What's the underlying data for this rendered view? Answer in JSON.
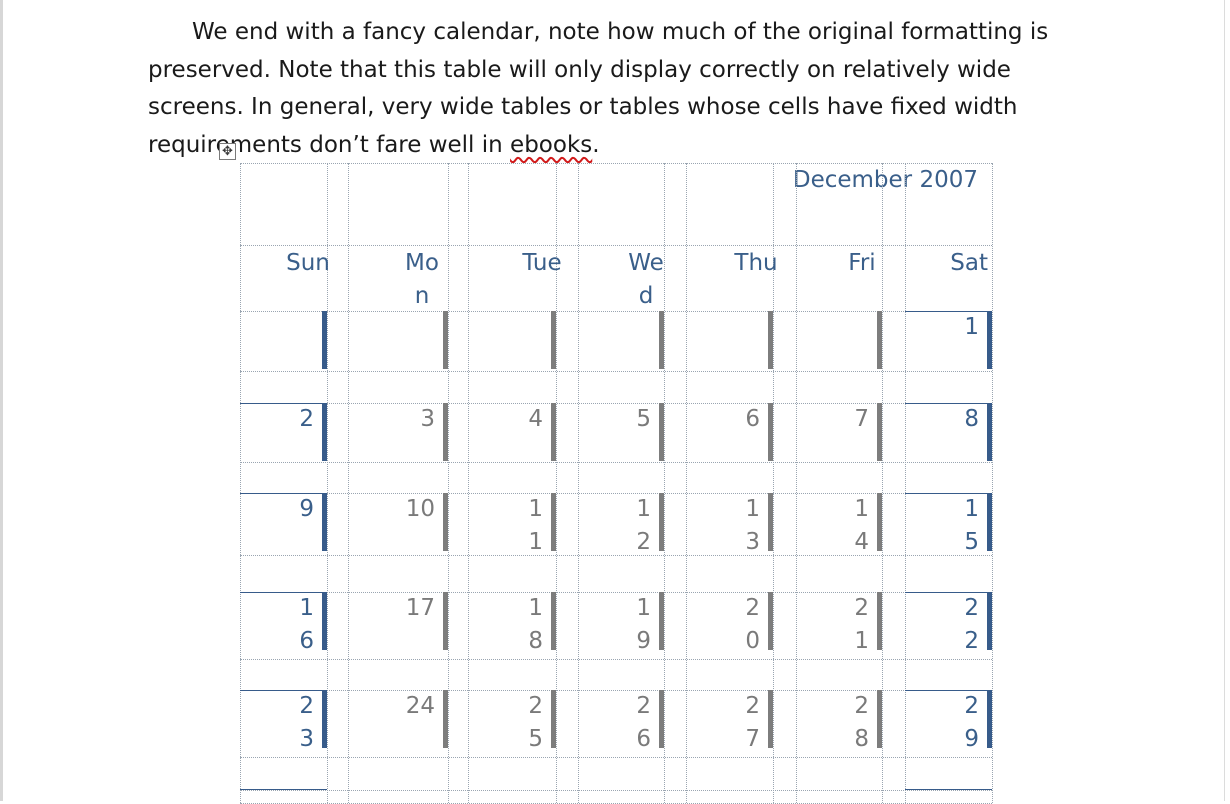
{
  "document": {
    "paragraph": {
      "before": "We end with a fancy calendar, note how much of the original formatting is preserved. Note that this table will only display correctly on relatively wide screens. In general, very wide tables or tables whose cells have fixed width requirements don’t fare well in ",
      "misspelled_word": "ebooks",
      "after": "."
    }
  },
  "table_handle": {
    "icon": "move-icon",
    "glyph": "✥"
  },
  "calendar": {
    "month_title": "December 2007",
    "day_headers": [
      "Sun",
      "Mon",
      "Tue",
      "Wed",
      "Thu",
      "Fri",
      "Sat"
    ],
    "weeks": [
      [
        "",
        "",
        "",
        "",
        "",
        "",
        "1"
      ],
      [
        "2",
        "3",
        "4",
        "5",
        "6",
        "7",
        "8"
      ],
      [
        "9",
        "10",
        "11",
        "12",
        "13",
        "14",
        "15"
      ],
      [
        "16",
        "17",
        "18",
        "19",
        "20",
        "21",
        "22"
      ],
      [
        "23",
        "24",
        "25",
        "26",
        "27",
        "28",
        "29"
      ]
    ],
    "colors": {
      "weekend_accent": "#375b8a",
      "weekday_accent": "#7d7d7d",
      "header_text": "#3a5f8a"
    }
  }
}
